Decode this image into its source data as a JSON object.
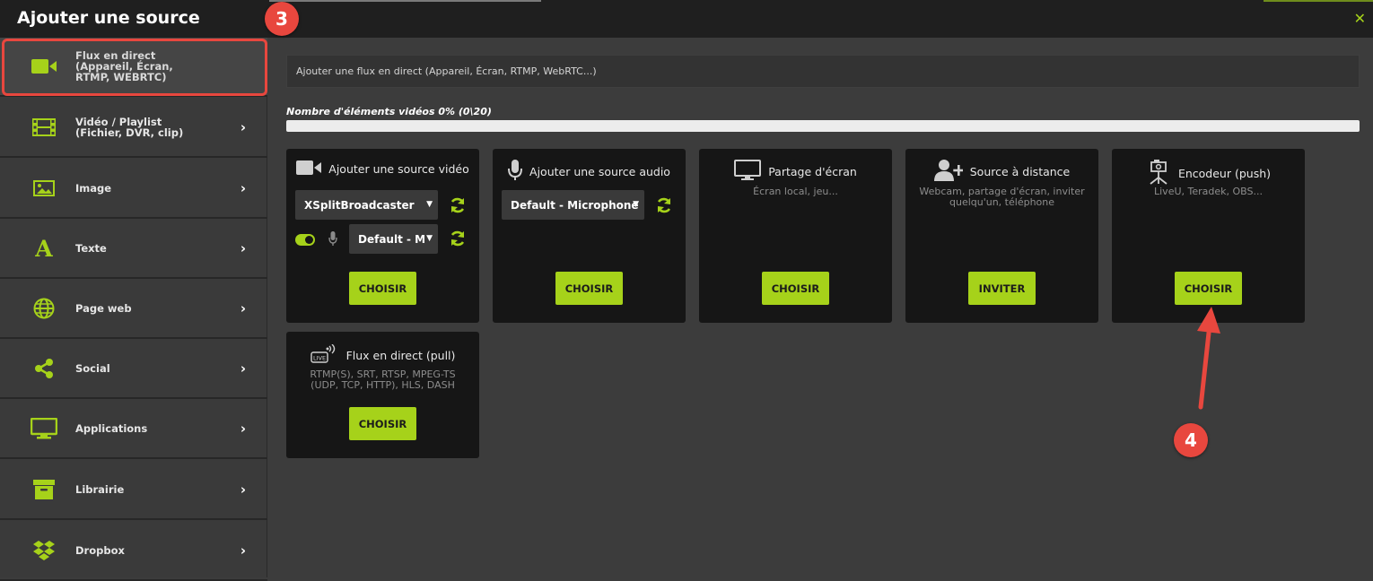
{
  "window": {
    "title": "Ajouter une source",
    "close_icon": "close-icon"
  },
  "sidebar": {
    "items": [
      {
        "label": "Flux en direct\n(Appareil, Écran,\nRTMP, WEBRTC)",
        "icon": "video-camera-icon",
        "active": true
      },
      {
        "label": "Vidéo / Playlist\n(Fichier, DVR, clip)",
        "icon": "film-icon",
        "chevron": true
      },
      {
        "label": "Image",
        "icon": "image-icon",
        "chevron": true
      },
      {
        "label": "Texte",
        "icon": "text-icon",
        "chevron": true
      },
      {
        "label": "Page web",
        "icon": "globe-icon",
        "chevron": true
      },
      {
        "label": "Social",
        "icon": "share-icon",
        "chevron": true
      },
      {
        "label": "Applications",
        "icon": "monitor-icon",
        "chevron": true
      },
      {
        "label": "Librairie",
        "icon": "archive-icon",
        "chevron": true
      },
      {
        "label": "Dropbox",
        "icon": "dropbox-icon",
        "chevron": true
      }
    ]
  },
  "annotations": {
    "step_left": "3",
    "step_right": "4"
  },
  "main": {
    "search_placeholder": "Ajouter une flux en direct (Appareil, Écran, RTMP, WebRTC...)",
    "count_label": "Nombre d'éléments vidéos 0% (0\\20)",
    "progress_fraction": 0.0,
    "cards": [
      {
        "title": "Ajouter une source vidéo",
        "icon": "video-camera-icon",
        "select_1": "XSplitBroadcaster",
        "select_2": "Default - M",
        "button": "CHOISIR"
      },
      {
        "title": "Ajouter une source audio",
        "icon": "microphone-icon",
        "select_1": "Default - Microphone",
        "button": "CHOISIR"
      },
      {
        "title": "Partage d'écran",
        "icon": "monitor-icon",
        "description": "Écran local, jeu...",
        "button": "CHOISIR"
      },
      {
        "title": "Source à distance",
        "icon": "add-user-icon",
        "description": "Webcam, partage d'écran, inviter quelqu'un, téléphone",
        "button": "INVITER"
      },
      {
        "title": "Encodeur (push)",
        "icon": "encoder-icon",
        "description": "LiveU, Teradek, OBS...",
        "button": "CHOISIR"
      },
      {
        "title": "Flux en direct (pull)",
        "icon": "live-icon",
        "description": "RTMP(S), SRT, RTSP, MPEG-TS (UDP, TCP, HTTP), HLS, DASH",
        "button": "CHOISIR"
      }
    ]
  },
  "colors": {
    "accent": "#a6d21a",
    "annotation": "#e8473e"
  }
}
